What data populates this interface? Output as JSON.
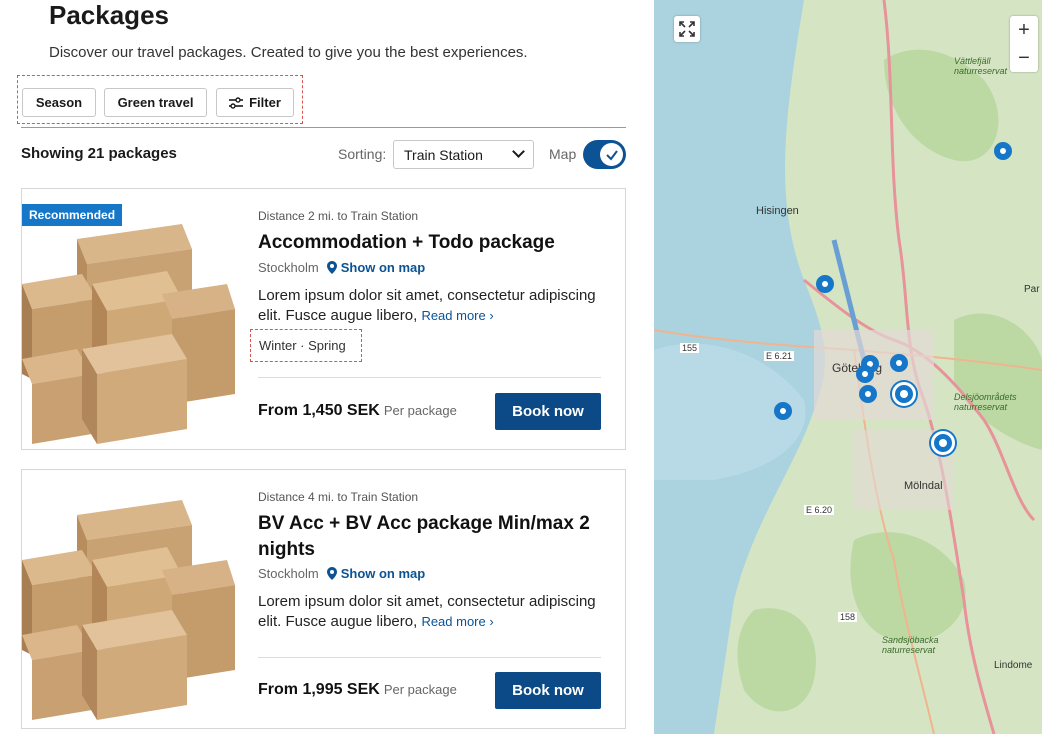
{
  "header": {
    "title": "Packages",
    "subtitle": "Discover our travel packages. Created to give you the best experiences."
  },
  "filters": {
    "season": "Season",
    "green_travel": "Green travel",
    "filter": "Filter"
  },
  "results": {
    "showing": "Showing 21 packages",
    "sorting_label": "Sorting:",
    "sorting_value": "Train Station",
    "map_label": "Map",
    "map_toggle_on": true
  },
  "cards": [
    {
      "badge": "Recommended",
      "distance": "Distance 2 mi. to Train Station",
      "title": "Accommodation + Todo package",
      "city": "Stockholm",
      "show_on_map": "Show on map",
      "description": "Lorem ipsum dolor sit amet, consectetur adipiscing elit. Fusce augue libero, ",
      "read_more": "Read more",
      "seasons": "Winter · Spring",
      "price": "From 1,450 SEK",
      "per": "Per package",
      "book": "Book now"
    },
    {
      "badge": "",
      "distance": "Distance 4 mi. to Train Station",
      "title": "BV Acc + BV Acc package Min/max 2 nights",
      "city": "Stockholm",
      "show_on_map": "Show on map",
      "description": "Lorem ipsum dolor sit amet, consectetur adipiscing elit. Fusce augue libero, ",
      "read_more": "Read more",
      "price": "From 1,995 SEK",
      "per": "Per package",
      "book": "Book now"
    }
  ],
  "map": {
    "zoom_in": "+",
    "zoom_out": "−",
    "labels": {
      "hisingen": "Hisingen",
      "goteborg": "Göteborg",
      "molndal": "Mölndal",
      "lindome": "Lindome",
      "e621": "E 6.21",
      "e620": "E 6.20",
      "r155": "155",
      "r158": "158",
      "reserve1": "Vättlefjäll naturreservat",
      "reserve2": "Delsjöområdets naturreservat",
      "reserve3": "Sandsjöbacka naturreservat",
      "par": "Par"
    }
  },
  "icons": {
    "expand": "expand-icon",
    "filter": "sliders-icon",
    "location": "location-pin-icon",
    "check": "check-icon",
    "chevron": "chevron-down-icon"
  },
  "colors": {
    "primary": "#0b4a86",
    "badge": "#1677c9",
    "pin": "#1677c9"
  }
}
